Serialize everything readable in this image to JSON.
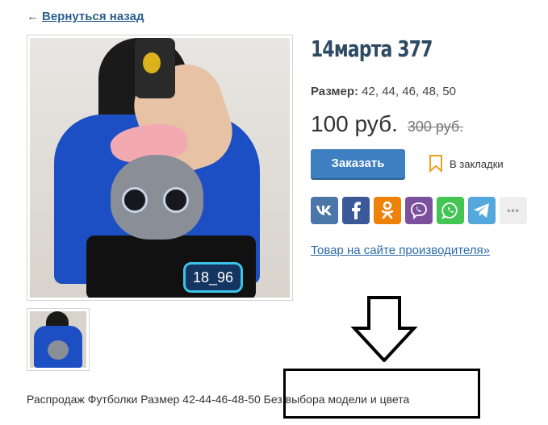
{
  "nav": {
    "back_arrow": "←",
    "back_label": "Вернуться назад"
  },
  "product": {
    "title": "14марта 377",
    "size_label": "Размер:",
    "sizes": "42, 44, 46, 48, 50",
    "price": "100 руб.",
    "old_price": "300 руб.",
    "order_label": "Заказать",
    "bookmark_label": "В закладки",
    "vendor_link": "Товар на сайте производителя»",
    "description": "Распродаж Футболки Размер 42-44-46-48-50 Без выбора модели и цвета",
    "photo_badge": "18_96"
  },
  "share": [
    {
      "name": "vk",
      "glyph": "vk",
      "color": "#4a76a8"
    },
    {
      "name": "facebook",
      "glyph": "f",
      "color": "#3b5998"
    },
    {
      "name": "odnoklassniki",
      "glyph": "ok",
      "color": "#ee8208"
    },
    {
      "name": "viber",
      "glyph": "viber",
      "color": "#7b519d"
    },
    {
      "name": "whatsapp",
      "glyph": "whatsapp",
      "color": "#43c553"
    },
    {
      "name": "telegram",
      "glyph": "telegram",
      "color": "#55a8dc"
    },
    {
      "name": "more",
      "glyph": "•••",
      "color": "#e8e8e8"
    }
  ],
  "colors": {
    "link": "#2a5f8f",
    "order_button": "#3d7fc1",
    "bookmark_icon": "#f0a020"
  }
}
